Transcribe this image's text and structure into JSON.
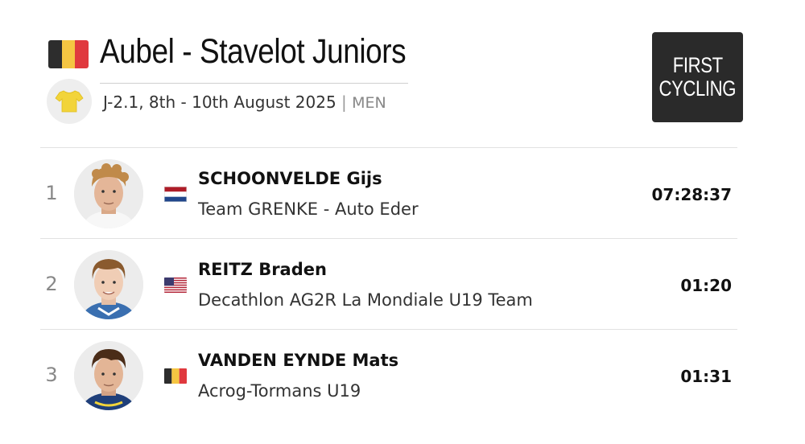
{
  "race": {
    "title": "Aubel - Stavelot Juniors",
    "details": "J-2.1, 8th - 10th August 2025",
    "separator": "|",
    "category": "MEN",
    "country_flag": "belgium-flag",
    "jersey_icon": "yellow-jersey-icon"
  },
  "logo": {
    "line1": "FIRST",
    "line2": "CYCLING"
  },
  "results": [
    {
      "position": "1",
      "name": "SCHOONVELDE Gijs",
      "team": "Team GRENKE - Auto Eder",
      "time": "07:28:37",
      "flag": "netherlands-flag"
    },
    {
      "position": "2",
      "name": "REITZ Braden",
      "team": "Decathlon AG2R La Mondiale U19 Team",
      "time": "01:20",
      "flag": "united-states-flag"
    },
    {
      "position": "3",
      "name": "VANDEN EYNDE Mats",
      "team": "Acrog-Tormans U19",
      "time": "01:31",
      "flag": "belgium-flag"
    }
  ],
  "colors": {
    "belgium": [
      "#2d2d2d",
      "#f5c542",
      "#e0393e"
    ],
    "netherlands": [
      "#ae1c28",
      "#ffffff",
      "#21468b"
    ],
    "usa_red": "#b22234",
    "usa_blue": "#3c3b6e",
    "jersey": "#f2d43a",
    "logo_bg": "#2a2a2a"
  }
}
